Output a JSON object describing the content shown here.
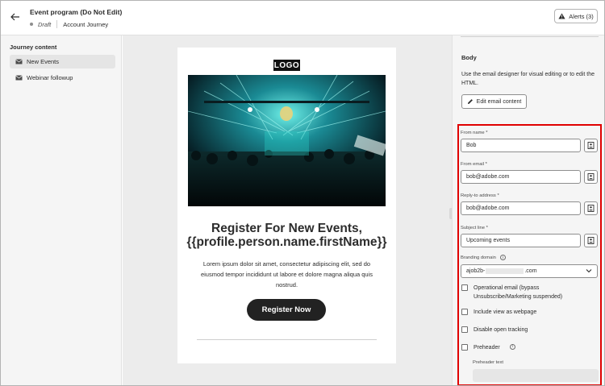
{
  "header": {
    "title": "Event program (Do Not Edit)",
    "status": "Draft",
    "journey": "Account Journey",
    "alerts_label": "Alerts (3)"
  },
  "sidebar": {
    "title": "Journey content",
    "items": [
      {
        "label": "New Events",
        "selected": true,
        "icon": "mail-icon"
      },
      {
        "label": "Webinar followup",
        "selected": false,
        "icon": "mail-icon"
      }
    ]
  },
  "email_preview": {
    "logo_text": "LOGO",
    "headline_line1": "Register For New Events,",
    "headline_line2": "{{profile.person.name.firstName}}",
    "body_line1": "Lorem ipsum dolor sit amet, consectetur adipiscing elit, sed do",
    "body_line2": "eiusmod tempor incididunt ut labore et dolore magna aliqua quis",
    "body_line3": "nostrud.",
    "cta_label": "Register Now"
  },
  "properties": {
    "body_title": "Body",
    "body_description": "Use the email designer for visual editing or to edit the HTML.",
    "edit_button": "Edit email content",
    "from_name_label": "From name",
    "from_name_value": "Bob",
    "from_email_label": "From email",
    "from_email_value": "bob@adobe.com",
    "reply_to_label": "Reply-to address",
    "reply_to_value": "bob@adobe.com",
    "subject_label": "Subject line",
    "subject_value": "Upcoming events",
    "required_marker": "*",
    "branding_label": "Branding domain",
    "branding_prefix": "ajob2b-",
    "branding_suffix": ".com",
    "operational_line1": "Operational email (bypass",
    "operational_line2": "Unsubscribe/Marketing suspended)",
    "include_webpage": "Include view as webpage",
    "disable_tracking": "Disable open tracking",
    "preheader": "Preheader",
    "preheader_text_label": "Preheader text",
    "info_glyph": "i"
  },
  "colors": {
    "highlight_border": "#e00000",
    "cta_background": "#222222"
  }
}
